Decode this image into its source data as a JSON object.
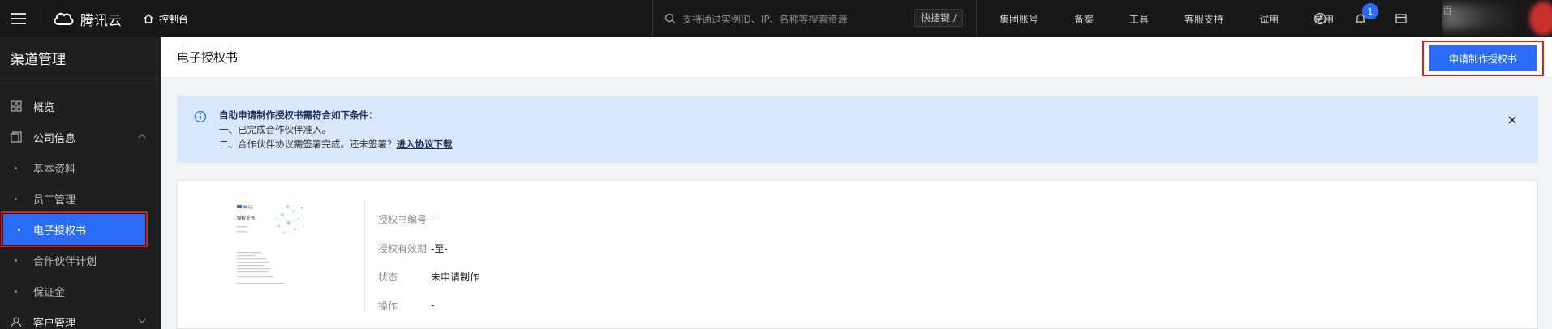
{
  "topbar": {
    "brand": "腾讯云",
    "console": "控制台",
    "search_placeholder": "支持通过实例ID、IP、名称等搜索资源",
    "shortcut": "快捷键 /",
    "nav": [
      "集团账号",
      "备案",
      "工具",
      "客服支持",
      "试用",
      "费用"
    ],
    "notification_count": "1",
    "user_initial": "百"
  },
  "sidebar": {
    "title": "渠道管理",
    "items": [
      {
        "label": "概览",
        "icon": "grid-icon"
      },
      {
        "label": "公司信息",
        "icon": "document-icon",
        "expanded": true
      }
    ],
    "subitems": [
      "基本资料",
      "员工管理",
      "电子授权书",
      "合作伙伴计划",
      "保证金"
    ],
    "active": "电子授权书",
    "next_group": "客户管理"
  },
  "page": {
    "title": "电子授权书",
    "apply_button": "申请制作授权书"
  },
  "notice": {
    "heading": "自助申请制作授权书需符合如下条件：",
    "line1": "一、已完成合作伙伴准入。",
    "line2": "二、合作伙伴协议需签署完成。还未签署？",
    "link": "进入协议下载"
  },
  "certificate": {
    "fields": [
      {
        "label": "授权书编号",
        "value": "--"
      },
      {
        "label": "授权有效期",
        "value": "-至-"
      },
      {
        "label": "状态",
        "value": "未申请制作"
      },
      {
        "label": "操作",
        "value": "-"
      }
    ],
    "thumb_brand": "腾讯云",
    "thumb_title": "授权证书"
  },
  "colors": {
    "accent": "#2a6cf5",
    "highlight": "#e01e1e",
    "topbar": "#181818",
    "sidebar": "#1f1f1f",
    "notice_bg": "#d9e7fd"
  }
}
